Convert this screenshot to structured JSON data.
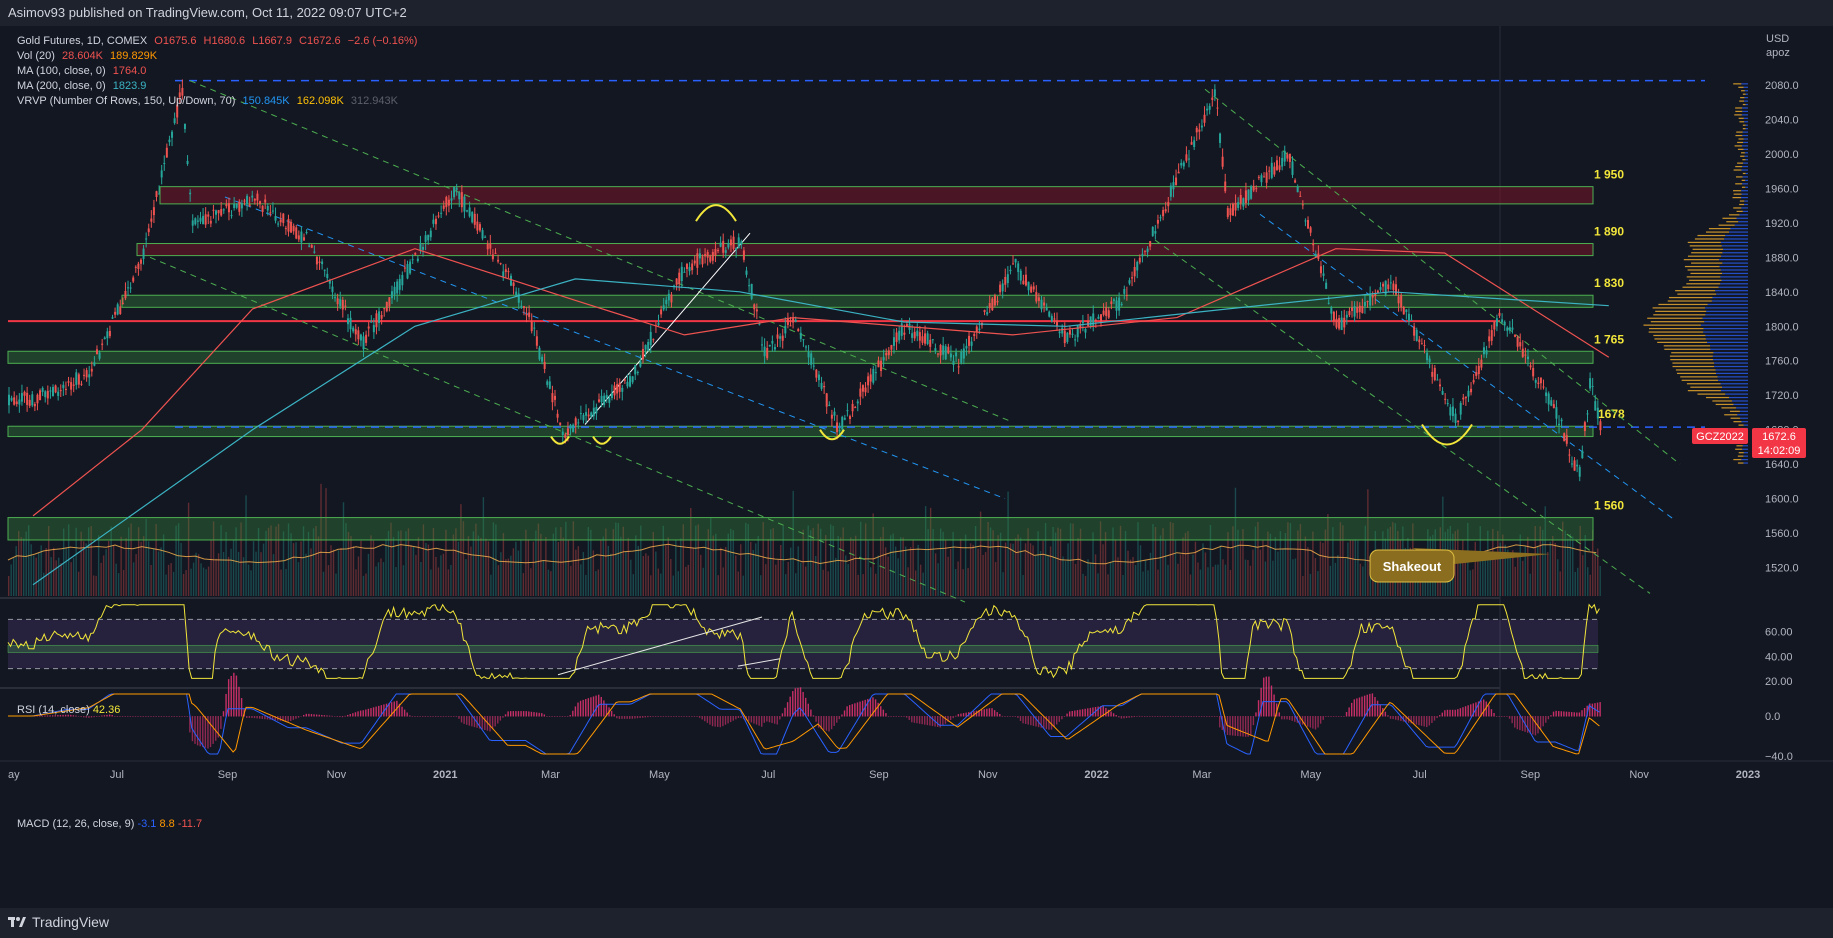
{
  "header": {
    "published": "Asimov93 published on TradingView.com, Oct 11, 2022 09:07 UTC+2"
  },
  "legend": {
    "symbol": "Gold Futures, 1D, COMEX",
    "o": "O1675.6",
    "h": "H1680.6",
    "l": "L1667.9",
    "c": "C1672.6",
    "chg": "−2.6 (−0.16%)",
    "vol_label": "Vol (20)",
    "vol1": "28.604K",
    "vol2": "189.829K",
    "ma100_label": "MA (100, close, 0)",
    "ma100": "1764.0",
    "ma200_label": "MA (200, close, 0)",
    "ma200": "1823.9",
    "vrvp_label": "VRVP (Number Of Rows, 150, Up/Down, 70)",
    "vrvp1": "150.845K",
    "vrvp2": "162.098K",
    "vrvp3": "312.943K",
    "rsi_label": "RSI (14, close)",
    "rsi": "42.36",
    "macd_label": "MACD (12, 26, close, 9)",
    "macd1": "-3.1",
    "macd2": "8.8",
    "macd3": "-11.7"
  },
  "footer": {
    "brand": "TradingView"
  },
  "colors": {
    "bg": "#131722",
    "up": "#26a69a",
    "down": "#ef5350",
    "ma100": "#ef5350",
    "ma200": "#3bb3c3",
    "zone_fill": "#1b5e20",
    "zone_border": "#4caf50",
    "zone_red": "#5d1a24",
    "rsi": "#f2e63a",
    "macd": "#2962ff",
    "signal": "#ff9800",
    "dash_blue": "#2962ff",
    "green_dash": "#4caf50"
  },
  "chart_data": {
    "type": "candlestick",
    "title": "Gold Futures, 1D, COMEX",
    "symbol": "GCZ2022",
    "currency_label": "USD",
    "currency_sub": "apoz",
    "last_price": "1672.6",
    "countdown": "14:02:09",
    "ylim": [
      1487,
      2102
    ],
    "y_ticks": [
      "2080.0",
      "2040.0",
      "2000.0",
      "1960.0",
      "1920.0",
      "1880.0",
      "1840.0",
      "1800.0",
      "1760.0",
      "1720.0",
      "1680.0",
      "1640.0",
      "1600.0",
      "1560.0",
      "1520.0"
    ],
    "x_ticks": [
      "ay",
      "Jul",
      "Sep",
      "Nov",
      "2021",
      "Mar",
      "May",
      "Jul",
      "Sep",
      "Nov",
      "2022",
      "Mar",
      "May",
      "Jul",
      "Sep",
      "Nov",
      "2023"
    ],
    "price_path": [
      {
        "t": "2020-05",
        "price": 1715
      },
      {
        "t": "2020-06",
        "price": 1745
      },
      {
        "t": "2020-07",
        "price": 1880
      },
      {
        "t": "2020-08-06",
        "price": 2075
      },
      {
        "t": "2020-08-12",
        "price": 1915
      },
      {
        "t": "2020-09",
        "price": 1950
      },
      {
        "t": "2020-10",
        "price": 1900
      },
      {
        "t": "2020-11",
        "price": 1780
      },
      {
        "t": "2020-12",
        "price": 1880
      },
      {
        "t": "2021-01-06",
        "price": 1960
      },
      {
        "t": "2021-02",
        "price": 1820
      },
      {
        "t": "2021-03-08",
        "price": 1676
      },
      {
        "t": "2021-04",
        "price": 1740
      },
      {
        "t": "2021-05",
        "price": 1870
      },
      {
        "t": "2021-06",
        "price": 1900
      },
      {
        "t": "2021-06-29",
        "price": 1765
      },
      {
        "t": "2021-07",
        "price": 1810
      },
      {
        "t": "2021-08-09",
        "price": 1680
      },
      {
        "t": "2021-09",
        "price": 1800
      },
      {
        "t": "2021-10",
        "price": 1760
      },
      {
        "t": "2021-11-16",
        "price": 1870
      },
      {
        "t": "2021-12",
        "price": 1785
      },
      {
        "t": "2022-01",
        "price": 1830
      },
      {
        "t": "2022-03-08",
        "price": 2070
      },
      {
        "t": "2022-03",
        "price": 1930
      },
      {
        "t": "2022-04-18",
        "price": 2000
      },
      {
        "t": "2022-05",
        "price": 1800
      },
      {
        "t": "2022-06",
        "price": 1850
      },
      {
        "t": "2022-07-21",
        "price": 1690
      },
      {
        "t": "2022-08",
        "price": 1815
      },
      {
        "t": "2022-09",
        "price": 1700
      },
      {
        "t": "2022-09-28",
        "price": 1625
      },
      {
        "t": "2022-10-04",
        "price": 1735
      },
      {
        "t": "2022-10-11",
        "price": 1672.6
      }
    ],
    "ma100_path": [
      {
        "t": "2020-05",
        "value": 1580
      },
      {
        "t": "2020-07",
        "value": 1680
      },
      {
        "t": "2020-09",
        "value": 1820
      },
      {
        "t": "2020-12",
        "value": 1890
      },
      {
        "t": "2021-03",
        "value": 1830
      },
      {
        "t": "2021-05",
        "value": 1790
      },
      {
        "t": "2021-07",
        "value": 1810
      },
      {
        "t": "2021-11",
        "value": 1790
      },
      {
        "t": "2022-02",
        "value": 1810
      },
      {
        "t": "2022-05",
        "value": 1890
      },
      {
        "t": "2022-07",
        "value": 1885
      },
      {
        "t": "2022-10",
        "value": 1764
      }
    ],
    "ma200_path": [
      {
        "t": "2020-05",
        "value": 1500
      },
      {
        "t": "2020-09",
        "value": 1680
      },
      {
        "t": "2020-12",
        "value": 1800
      },
      {
        "t": "2021-03",
        "value": 1855
      },
      {
        "t": "2021-06",
        "value": 1840
      },
      {
        "t": "2021-09",
        "value": 1805
      },
      {
        "t": "2021-12",
        "value": 1800
      },
      {
        "t": "2022-03",
        "value": 1820
      },
      {
        "t": "2022-06",
        "value": 1840
      },
      {
        "t": "2022-10",
        "value": 1823.9
      }
    ],
    "zones": [
      {
        "label": "1 950",
        "low": 1942,
        "high": 1962,
        "color": "red"
      },
      {
        "label": "1 890",
        "low": 1882,
        "high": 1896,
        "color": "red"
      },
      {
        "label": "1 830",
        "low": 1822,
        "high": 1836,
        "color": "green"
      },
      {
        "label": "1 765",
        "low": 1757,
        "high": 1771,
        "color": "green"
      },
      {
        "label": "1678",
        "low": 1672,
        "high": 1684,
        "color": "green"
      },
      {
        "label": "1 560",
        "low": 1552,
        "high": 1578,
        "color": "green"
      }
    ],
    "horizontal_lines": [
      {
        "value": 2085,
        "style": "dashed",
        "color": "blue"
      },
      {
        "value": 1806,
        "style": "solid",
        "color": "red"
      },
      {
        "value": 1683,
        "style": "dashed",
        "color": "blue"
      }
    ],
    "annotations": [
      {
        "text": "Shakeout",
        "type": "callout"
      }
    ],
    "rsi": {
      "ticks": [
        "60.00",
        "40.00",
        "20.00"
      ],
      "overbought": 70,
      "oversold": 30,
      "value": 42.36
    },
    "macd": {
      "ticks": [
        "0.0",
        "−40.0"
      ],
      "macd": -3.1,
      "signal": 8.8,
      "hist": -11.7
    }
  }
}
